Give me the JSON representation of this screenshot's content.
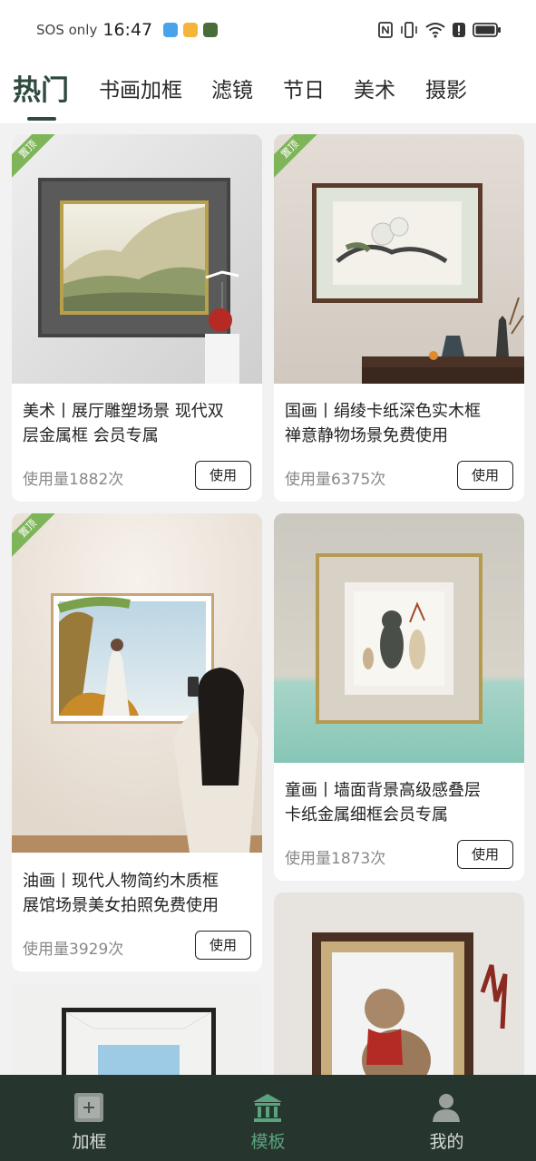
{
  "status_bar": {
    "carrier": "SOS only",
    "time": "16:47"
  },
  "tabs": [
    {
      "label": "热门",
      "active": true
    },
    {
      "label": "书画加框",
      "active": false
    },
    {
      "label": "滤镜",
      "active": false
    },
    {
      "label": "节日",
      "active": false
    },
    {
      "label": "美术",
      "active": false
    },
    {
      "label": "摄影",
      "active": false
    }
  ],
  "cards": [
    {
      "badge": "置顶",
      "title_line1": "美术丨展厅雕塑场景 现代双",
      "title_line2": "层金属框 会员专属",
      "usage": "使用量1882次",
      "button": "使用"
    },
    {
      "badge": "置顶",
      "title_line1": "国画丨绢绫卡纸深色实木框",
      "title_line2": "禅意静物场景免费使用",
      "usage": "使用量6375次",
      "button": "使用"
    },
    {
      "badge": "置顶",
      "title_line1": "油画丨现代人物简约木质框",
      "title_line2": "展馆场景美女拍照免费使用",
      "usage": "使用量3929次",
      "button": "使用"
    },
    {
      "badge": "",
      "title_line1": "童画丨墙面背景高级感叠层",
      "title_line2": "卡纸金属细框会员专属",
      "usage": "使用量1873次",
      "button": "使用"
    }
  ],
  "bottom_nav": [
    {
      "label": "加框",
      "icon": "frame-icon",
      "active": false
    },
    {
      "label": "模板",
      "icon": "museum-icon",
      "active": true
    },
    {
      "label": "我的",
      "icon": "person-icon",
      "active": false
    }
  ],
  "colors": {
    "accent": "#2f4a3f",
    "nav_bg": "#27352f",
    "nav_active": "#5aa37d",
    "badge": "#7fb559"
  }
}
